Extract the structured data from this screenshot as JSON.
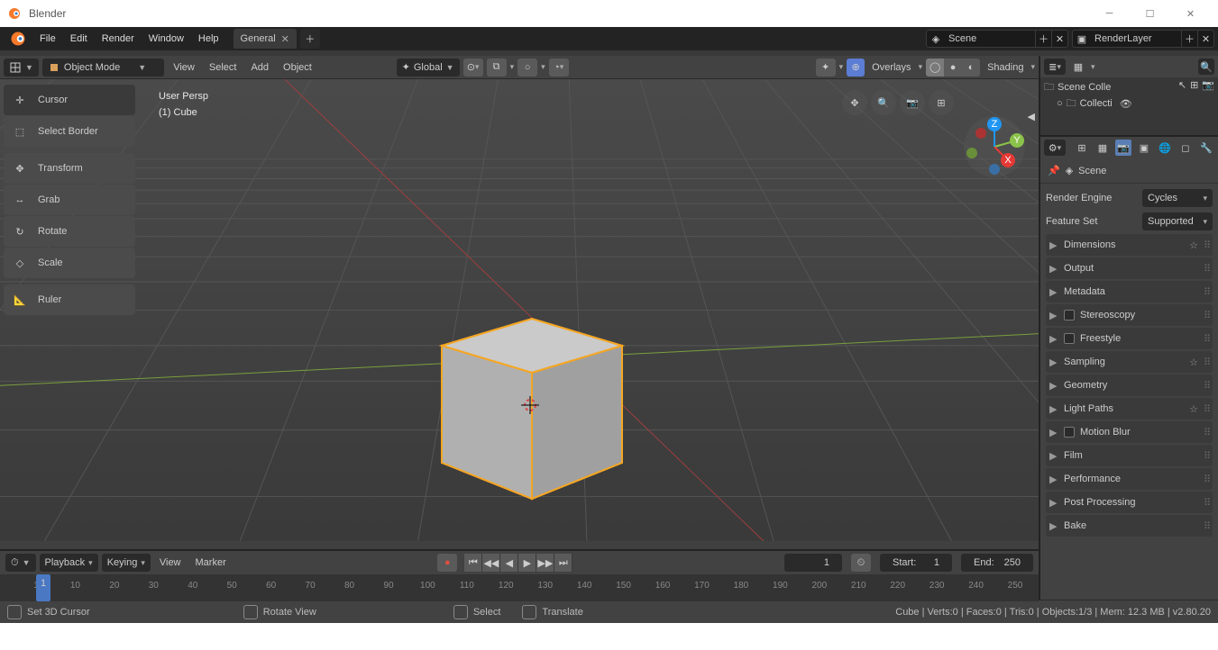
{
  "window": {
    "title": "Blender"
  },
  "menu": {
    "file": "File",
    "edit": "Edit",
    "render": "Render",
    "window": "Window",
    "help": "Help"
  },
  "workspace": {
    "tab": "General"
  },
  "scene_selector": {
    "scene": "Scene",
    "layer": "RenderLayer"
  },
  "viewport": {
    "editor": "3D Viewport",
    "mode": "Object Mode",
    "menus": {
      "view": "View",
      "select": "Select",
      "add": "Add",
      "object": "Object"
    },
    "orientation": "Global",
    "overlays": "Overlays",
    "shading": "Shading",
    "info": {
      "persp": "User Persp",
      "object": "(1) Cube"
    },
    "tools": {
      "cursor": "Cursor",
      "select_border": "Select Border",
      "transform": "Transform",
      "grab": "Grab",
      "rotate": "Rotate",
      "scale": "Scale",
      "ruler": "Ruler"
    }
  },
  "timeline": {
    "menus": {
      "playback": "Playback",
      "keying": "Keying",
      "view": "View",
      "marker": "Marker"
    },
    "current": "1",
    "frame_label": "1",
    "start_label": "Start:",
    "start": "1",
    "end_label": "End:",
    "end": "250",
    "ticks": [
      "1",
      "10",
      "20",
      "30",
      "40",
      "50",
      "60",
      "70",
      "80",
      "90",
      "100",
      "110",
      "120",
      "130",
      "140",
      "150",
      "160",
      "170",
      "180",
      "190",
      "200",
      "210",
      "220",
      "230",
      "240",
      "250"
    ]
  },
  "statusbar": {
    "set_cursor": "Set 3D Cursor",
    "rotate": "Rotate View",
    "select": "Select",
    "translate": "Translate",
    "stats": "Cube | Verts:0 | Faces:0 | Tris:0 | Objects:1/3 | Mem: 12.3 MB | v2.80.20"
  },
  "outliner": {
    "scene_coll": "Scene Colle",
    "collection": "Collecti"
  },
  "properties": {
    "context": "Scene",
    "render_engine": {
      "label": "Render Engine",
      "value": "Cycles"
    },
    "feature_set": {
      "label": "Feature Set",
      "value": "Supported"
    },
    "panels": {
      "dimensions": "Dimensions",
      "output": "Output",
      "metadata": "Metadata",
      "stereoscopy": "Stereoscopy",
      "freestyle": "Freestyle",
      "sampling": "Sampling",
      "geometry": "Geometry",
      "light_paths": "Light Paths",
      "motion_blur": "Motion Blur",
      "film": "Film",
      "performance": "Performance",
      "post_processing": "Post Processing",
      "bake": "Bake"
    }
  }
}
